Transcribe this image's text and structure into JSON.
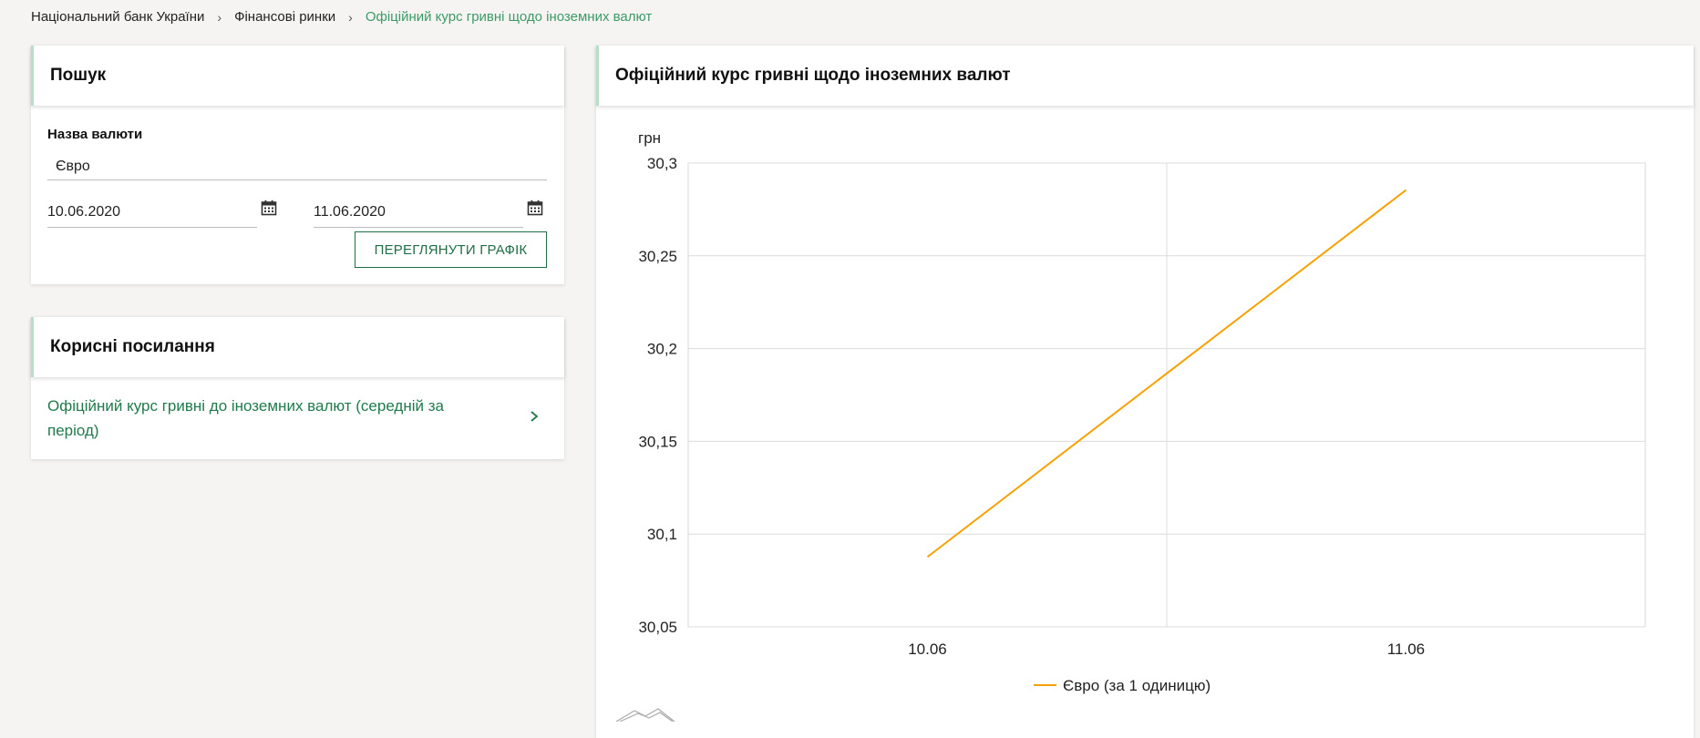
{
  "breadcrumb": {
    "items": [
      "Національний банк України",
      "Фінансові ринки",
      "Офіційний курс гривні щодо іноземних валют"
    ]
  },
  "search": {
    "title": "Пошук",
    "currency_label": "Назва валюти",
    "currency_value": "Євро",
    "date_from": "10.06.2020",
    "date_to": "11.06.2020",
    "view_button": "ПЕРЕГЛЯНУТИ ГРАФІК",
    "calendar_icon": "calendar-icon"
  },
  "links": {
    "title": "Корисні посилання",
    "items": [
      {
        "label": "Офіційний курс гривні до іноземних валют (середній за період)",
        "icon": "chevron-right-icon"
      }
    ]
  },
  "chart_panel": {
    "title": "Офіційний курс гривні щодо іноземних валют"
  },
  "colors": {
    "accent_green": "#1f7a4c",
    "breadcrumb_current": "#3c9a68",
    "series": "#f5a100"
  },
  "chart_data": {
    "type": "line",
    "ylabel": "грн",
    "xlabel": "",
    "categories": [
      "10.06",
      "11.06"
    ],
    "series": [
      {
        "name": "Євро (за 1 одиницю)",
        "values": [
          30.0877,
          30.2855
        ]
      }
    ],
    "ylim": [
      30.05,
      30.3
    ],
    "yticks": [
      "30,3",
      "30,25",
      "30,2",
      "30,15",
      "30,1",
      "30,05"
    ],
    "ytick_values": [
      30.3,
      30.25,
      30.2,
      30.15,
      30.1,
      30.05
    ],
    "grid": true,
    "legend": "bottom-center"
  }
}
